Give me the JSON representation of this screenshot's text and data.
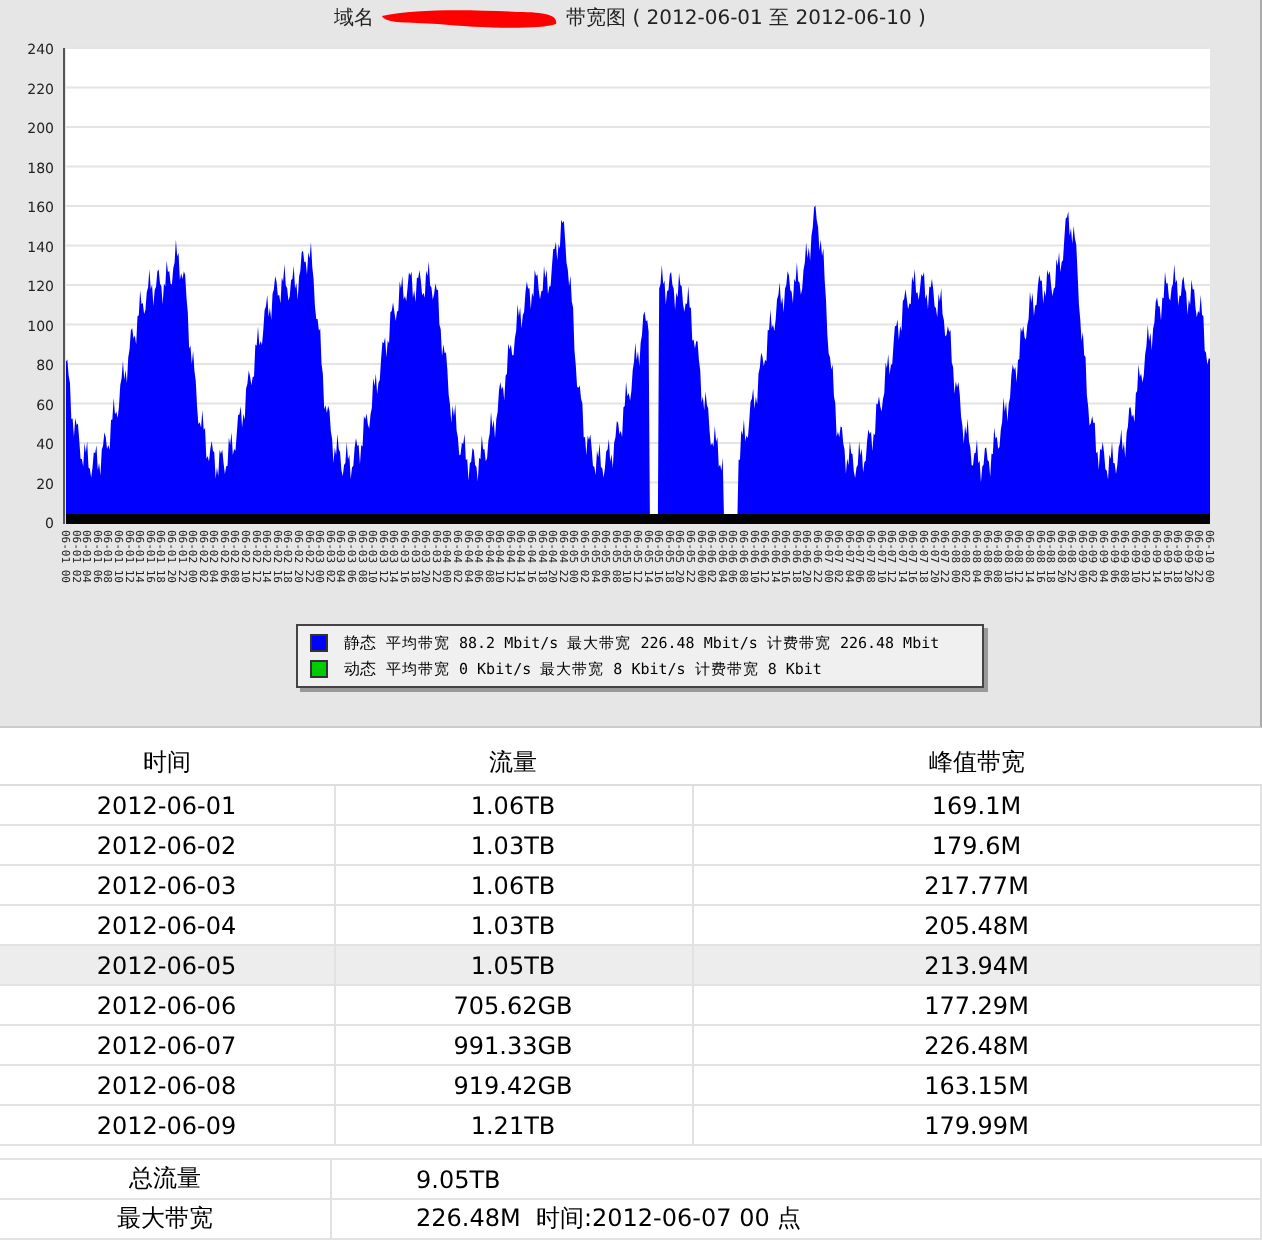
{
  "chart": {
    "title_prefix": "域名",
    "title_suffix": "带宽图 ( 2012-06-01 至 2012-06-10 )",
    "y_axis_labels": [
      "240",
      "220",
      "200",
      "180",
      "160",
      "140",
      "120",
      "100",
      "80",
      "60",
      "40",
      "20",
      "0"
    ],
    "x_axis_labels": [
      "06-01 00",
      "06-01 02",
      "06-01 04",
      "06-01 06",
      "06-01 08",
      "06-01 10",
      "06-01 12",
      "06-01 14",
      "06-01 16",
      "06-01 18",
      "06-01 20",
      "06-01 22",
      "06-02 00",
      "06-02 02",
      "06-02 04",
      "06-02 06",
      "06-02 08",
      "06-02 10",
      "06-02 12",
      "06-02 14",
      "06-02 16",
      "06-02 18",
      "06-02 20",
      "06-02 22",
      "06-03 00",
      "06-03 02",
      "06-03 04",
      "06-03 06",
      "06-03 08",
      "06-03 10",
      "06-03 12",
      "06-03 14",
      "06-03 16",
      "06-03 18",
      "06-03 20",
      "06-03 22",
      "06-04 00",
      "06-04 02",
      "06-04 04",
      "06-04 06",
      "06-04 08",
      "06-04 10",
      "06-04 12",
      "06-04 14",
      "06-04 16",
      "06-04 18",
      "06-04 20",
      "06-04 22",
      "06-05 00",
      "06-05 02",
      "06-05 04",
      "06-05 06",
      "06-05 08",
      "06-05 10",
      "06-05 12",
      "06-05 14",
      "06-05 16",
      "06-05 18",
      "06-05 20",
      "06-05 22",
      "06-06 00",
      "06-06 02",
      "06-06 04",
      "06-06 06",
      "06-06 08",
      "06-06 10",
      "06-06 12",
      "06-06 14",
      "06-06 16",
      "06-06 18",
      "06-06 20",
      "06-06 22",
      "06-07 00",
      "06-07 02",
      "06-07 04",
      "06-07 06",
      "06-07 08",
      "06-07 10",
      "06-07 12",
      "06-07 14",
      "06-07 16",
      "06-07 18",
      "06-07 20",
      "06-07 22",
      "06-08 00",
      "06-08 02",
      "06-08 04",
      "06-08 06",
      "06-08 08",
      "06-08 10",
      "06-08 12",
      "06-08 14",
      "06-08 16",
      "06-08 18",
      "06-08 20",
      "06-08 22",
      "06-09 00",
      "06-09 02",
      "06-09 04",
      "06-09 06",
      "06-09 08",
      "06-09 10",
      "06-09 12",
      "06-09 14",
      "06-09 16",
      "06-09 18",
      "06-09 20",
      "06-09 22",
      "06-10 00"
    ],
    "legend": [
      {
        "name": "静态",
        "stats": "平均带宽 88.2 Mbit/s 最大带宽 226.48 Mbit/s 计费带宽 226.48 Mbit",
        "color": "#0000ff"
      },
      {
        "name": "动态",
        "stats": "平均带宽 0 Kbit/s 最大带宽 8 Kbit/s 计费带宽 8 Kbit",
        "color": "#00cc00"
      }
    ]
  },
  "table": {
    "columns": [
      "时间",
      "流量",
      "峰值带宽"
    ],
    "rows": [
      {
        "cells": [
          "2012-06-01",
          "1.06TB",
          "169.1M"
        ],
        "selected": false
      },
      {
        "cells": [
          "2012-06-02",
          "1.03TB",
          "179.6M"
        ],
        "selected": false
      },
      {
        "cells": [
          "2012-06-03",
          "1.06TB",
          "217.77M"
        ],
        "selected": false
      },
      {
        "cells": [
          "2012-06-04",
          "1.03TB",
          "205.48M"
        ],
        "selected": false
      },
      {
        "cells": [
          "2012-06-05",
          "1.05TB",
          "213.94M"
        ],
        "selected": true
      },
      {
        "cells": [
          "2012-06-06",
          "705.62GB",
          "177.29M"
        ],
        "selected": false
      },
      {
        "cells": [
          "2012-06-07",
          "991.33GB",
          "226.48M"
        ],
        "selected": false
      },
      {
        "cells": [
          "2012-06-08",
          "919.42GB",
          "163.15M"
        ],
        "selected": false
      },
      {
        "cells": [
          "2012-06-09",
          "1.21TB",
          "179.99M"
        ],
        "selected": false
      }
    ]
  },
  "summary": [
    {
      "label": "总流量",
      "value": "9.05TB"
    },
    {
      "label": "最大带宽",
      "value": "226.48M  时间:2012-06-07 00 点"
    }
  ]
}
